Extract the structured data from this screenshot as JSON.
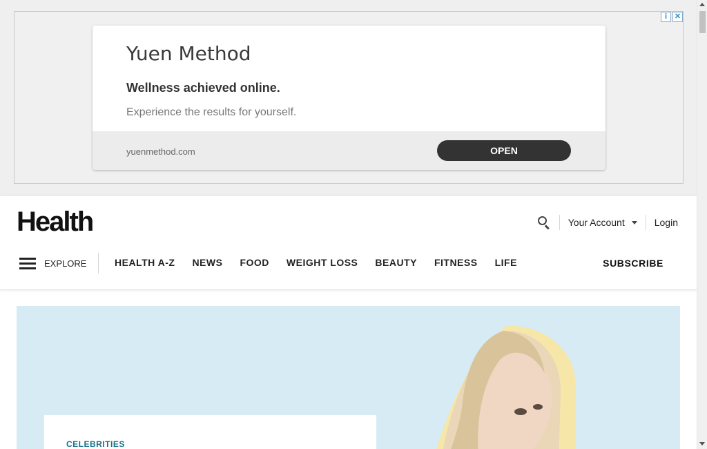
{
  "ad": {
    "title": "Yuen Method",
    "headline": "Wellness achieved online.",
    "description": "Experience the results for yourself.",
    "domain": "yuenmethod.com",
    "cta": "OPEN",
    "choices_info": "i",
    "choices_close": "✕"
  },
  "header": {
    "logo": "Health",
    "account_label": "Your Account",
    "login_label": "Login",
    "explore_label": "EXPLORE",
    "nav": [
      "HEALTH A-Z",
      "NEWS",
      "FOOD",
      "WEIGHT LOSS",
      "BEAUTY",
      "FITNESS",
      "LIFE"
    ],
    "subscribe_label": "SUBSCRIBE"
  },
  "hero": {
    "category": "CELEBRITIES"
  },
  "colors": {
    "hero_bg": "#d6ebf3",
    "category": "#1b6f8a",
    "cta_bg": "#333333"
  }
}
